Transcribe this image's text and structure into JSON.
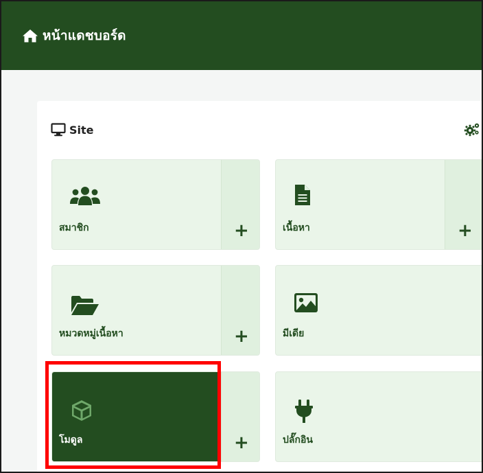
{
  "header": {
    "title": "หน้าแดชบอร์ด",
    "icon": "home-icon",
    "bg": "#234d20"
  },
  "card": {
    "title": "Site",
    "title_icon": "monitor-icon",
    "settings_icon": "cogs-icon"
  },
  "tiles": [
    {
      "label": "สมาชิก",
      "icon": "users-icon",
      "add_label": "+"
    },
    {
      "label": "เนื้อหา",
      "icon": "file-text-icon",
      "add_label": "+"
    },
    {
      "label": "หมวดหมู่เนื้อหา",
      "icon": "folder-open-icon",
      "add_label": "+"
    },
    {
      "label": "มีเดีย",
      "icon": "image-icon"
    },
    {
      "label": "โมดูล",
      "icon": "cube-icon",
      "add_label": "+",
      "active": true
    },
    {
      "label": "ปลั๊กอิน",
      "icon": "plug-icon"
    }
  ],
  "colors": {
    "accent": "#234d20",
    "tile_bg": "#eaf5e9",
    "highlight": "#ff0000"
  }
}
